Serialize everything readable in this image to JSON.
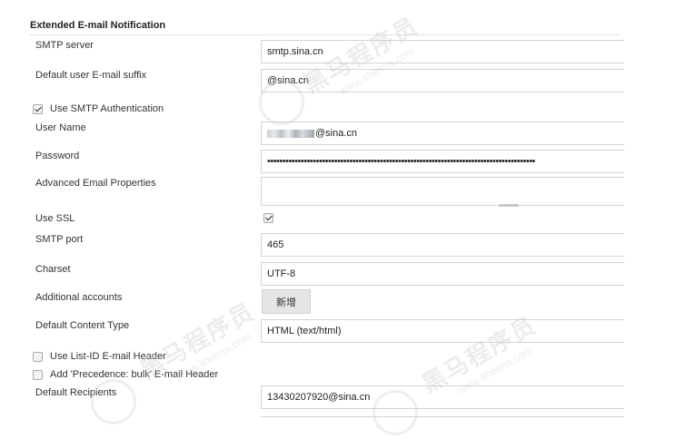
{
  "section": {
    "title": "Extended E-mail Notification"
  },
  "fields": {
    "smtp_server": {
      "label": "SMTP server",
      "value": "smtp.sina.cn"
    },
    "default_suffix": {
      "label": "Default user E-mail suffix",
      "value": "@sina.cn"
    },
    "use_smtp_auth": {
      "label": "Use SMTP Authentication",
      "checked": true
    },
    "user_name": {
      "label": "User Name",
      "value_visible": "@sina.cn"
    },
    "password": {
      "label": "Password",
      "value": "••••••••••••••••••••••••••••••••••••••••••••••••••••••••••••••••••••••••••••••••••••••••"
    },
    "advanced_props": {
      "label": "Advanced Email Properties",
      "value": ""
    },
    "use_ssl": {
      "label": "Use SSL",
      "checked": true
    },
    "smtp_port": {
      "label": "SMTP port",
      "value": "465"
    },
    "charset": {
      "label": "Charset",
      "value": "UTF-8"
    },
    "additional_accounts": {
      "label": "Additional accounts",
      "button_label": "新增"
    },
    "content_type": {
      "label": "Default Content Type",
      "value": "HTML (text/html)"
    },
    "list_id_header": {
      "label": "Use List-ID E-mail Header",
      "checked": false
    },
    "precedence_header": {
      "label": "Add 'Precedence: bulk' E-mail Header",
      "checked": false
    },
    "default_recipients": {
      "label": "Default Recipients",
      "value": "13430207920@sina.cn"
    }
  },
  "watermark": {
    "brand": "黑马程序员",
    "url": "www.itheima.com"
  }
}
